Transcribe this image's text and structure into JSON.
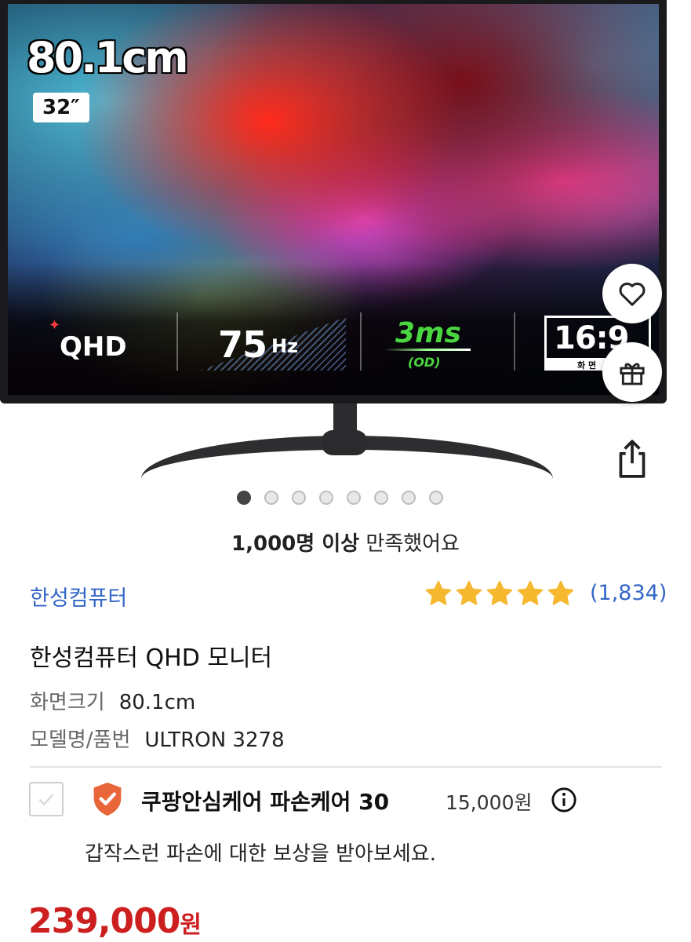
{
  "product_image": {
    "size_cm": "80.1cm",
    "size_inch": "32″",
    "badges": {
      "qhd": "QHD",
      "refresh_value": "75",
      "refresh_unit": "Hz",
      "response": "3ms",
      "response_sub": "(OD)",
      "aspect": "16:9",
      "aspect_sub": "화 면"
    }
  },
  "actions": {
    "wish_icon": "heart-icon",
    "gift_icon": "gift-icon",
    "share_icon": "share-icon"
  },
  "carousel": {
    "total": 8,
    "active_index": 0
  },
  "satisfaction": {
    "bold": "1,000명 이상",
    "text": " 만족했어요"
  },
  "brand": {
    "name": "한성컴퓨터"
  },
  "rating": {
    "stars": 5,
    "count": "(1,834)",
    "star_color": "#f5b82e"
  },
  "product": {
    "title": "한성컴퓨터 QHD 모니터",
    "attributes": [
      {
        "key": "화면크기",
        "value": "80.1cm"
      },
      {
        "key": "모델명/품번",
        "value": "ULTRON 3278"
      }
    ]
  },
  "care": {
    "name": "쿠팡안심케어 파손케어 30",
    "price": "15,000원",
    "description": "갑작스런 파손에 대한 보상을 받아보세요.",
    "shield_color": "#e8663a"
  },
  "price": {
    "amount": "239,000",
    "unit": "원",
    "color": "#cc1f1f"
  },
  "colors": {
    "link": "#3466c7"
  }
}
